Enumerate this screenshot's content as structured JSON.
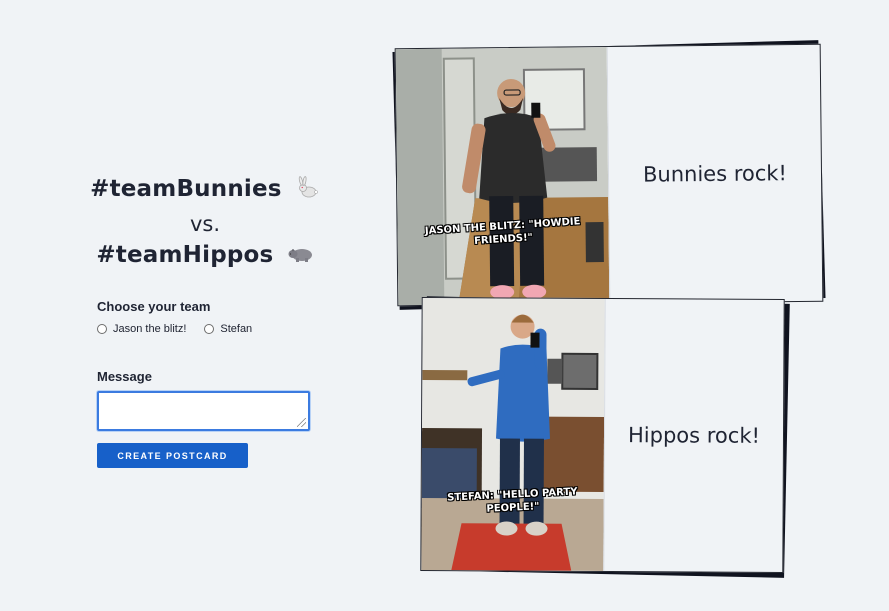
{
  "headline": {
    "team_one": "#teamBunnies",
    "team_one_icon": "rabbit-icon",
    "versus": "vs.",
    "team_two": "#teamHippos",
    "team_two_icon": "hippo-icon"
  },
  "form": {
    "team_label": "Choose your team",
    "options": [
      "Jason the blitz!",
      "Stefan"
    ],
    "message_label": "Message",
    "message_value": "",
    "submit_label": "CREATE POSTCARD"
  },
  "postcards": [
    {
      "caption": "JASON THE BLITZ: \"HOWDIE FRIENDS!\"",
      "message": "Bunnies rock!"
    },
    {
      "caption": "STEFAN: \"HELLO PARTY PEOPLE!\"",
      "message": "Hippos rock!"
    }
  ],
  "colors": {
    "accent": "#1760c9",
    "background": "#f0f3f6",
    "card_border": "#23262f"
  }
}
